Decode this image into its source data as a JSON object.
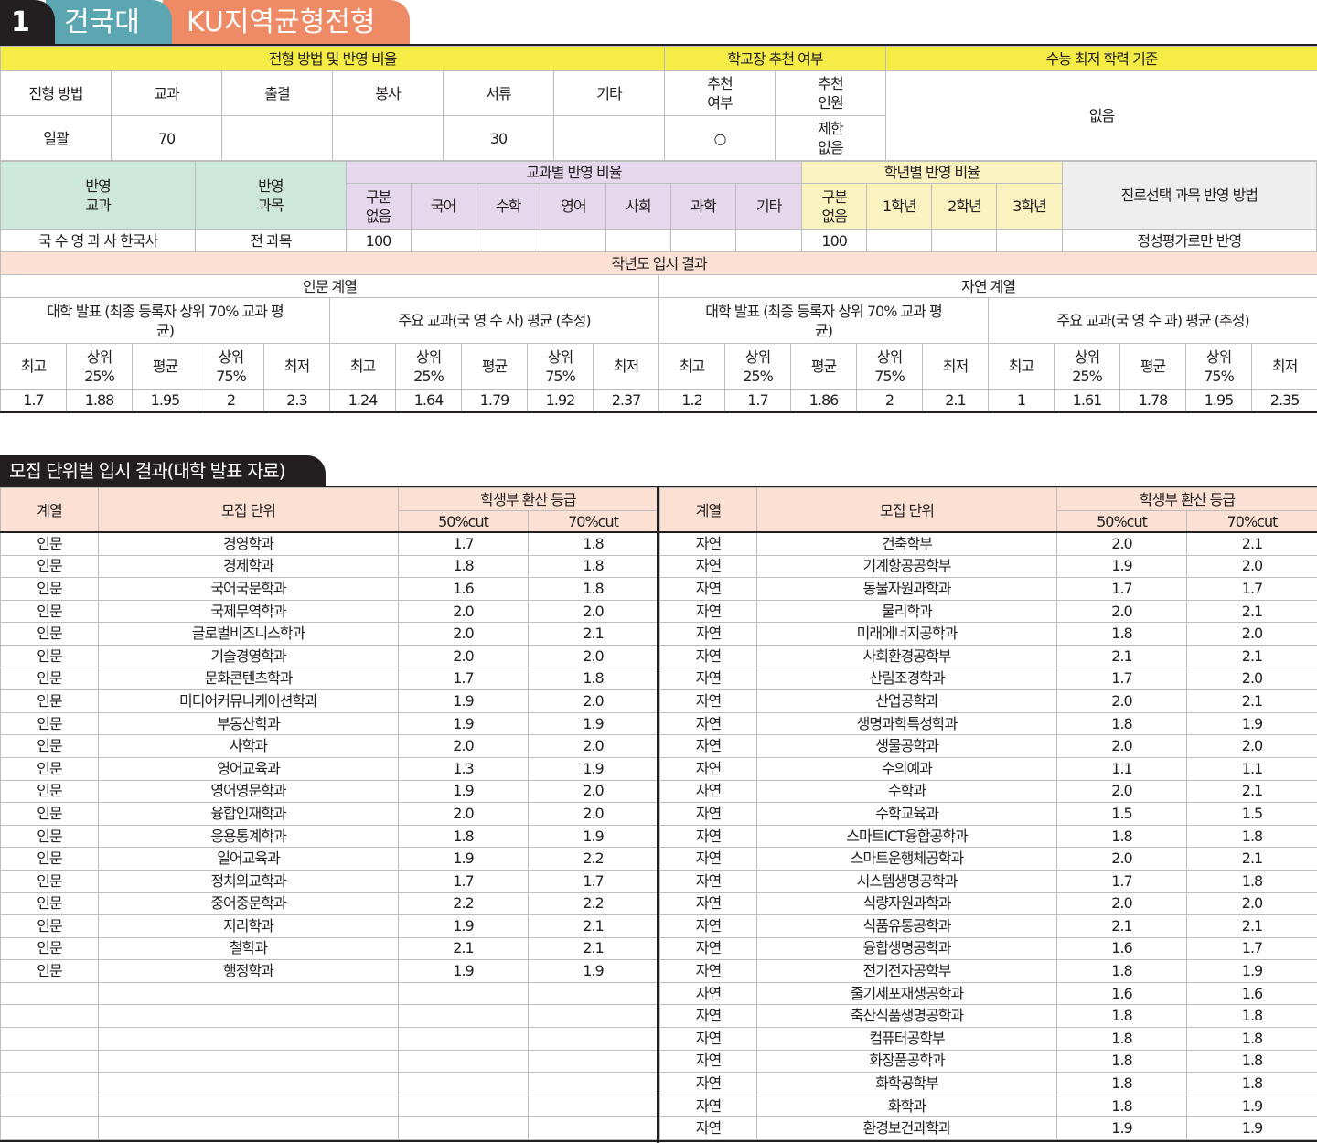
{
  "header": {
    "number": "1",
    "university": "건국대",
    "admission_type": "KU지역균형전형"
  },
  "t1": {
    "method_group": "전형 방법 및 반영 비율",
    "rec_group": "학교장 추천 여부",
    "min_group": "수능 최저 학력 기준",
    "cols": [
      "전형 방법",
      "교과",
      "출결",
      "봉사",
      "서류",
      "기타"
    ],
    "rec_cols": [
      "추천 여부",
      "추천 인원"
    ],
    "vals": [
      "일괄",
      "70",
      "",
      "",
      "30",
      ""
    ],
    "rec_vals": [
      "○",
      "제한 없음"
    ],
    "min_val": "없음"
  },
  "t2": {
    "reflect_subject": "반영 교과",
    "reflect_course": "반영 과목",
    "subj_group": "교과별 반영 비율",
    "grade_group": "학년별 반영 비율",
    "elective": "진로선택 과목 반영 방법",
    "subj_cols": [
      "구분 없음",
      "국어",
      "수학",
      "영어",
      "사회",
      "과학",
      "기타"
    ],
    "grade_cols": [
      "구분 없음",
      "1학년",
      "2학년",
      "3학년"
    ],
    "row": {
      "subject": "국 수 영 과 사 한국사",
      "course": "전 과목",
      "subj_vals": [
        "100",
        "",
        "",
        "",
        "",
        "",
        ""
      ],
      "grade_vals": [
        "100",
        "",
        "",
        ""
      ],
      "elective": "정성평가로만 반영"
    }
  },
  "t3": {
    "title": "작년도 입시 결과",
    "hum": "인문 계열",
    "nat": "자연 계열",
    "univ_hdr": "대학 발표 (최종 등록자 상위 70% 교과 평균)",
    "main_hum": "주요 교과(국 영 수 사) 평균 (추정)",
    "main_nat": "주요 교과(국 영 수 과) 평균 (추정)",
    "stat_cols": [
      "최고",
      "상위 25%",
      "평균",
      "상위 75%",
      "최저"
    ],
    "hum_univ": [
      "1.7",
      "1.88",
      "1.95",
      "2",
      "2.3"
    ],
    "hum_main": [
      "1.24",
      "1.64",
      "1.79",
      "1.92",
      "2.37"
    ],
    "nat_univ": [
      "1.2",
      "1.7",
      "1.86",
      "2",
      "2.1"
    ],
    "nat_main": [
      "1",
      "1.61",
      "1.78",
      "1.95",
      "2.35"
    ]
  },
  "sec2": {
    "title": "모집 단위별 입시 결과(대학 발표 자료)",
    "col_track": "계열",
    "col_unit": "모집 단위",
    "col_grade": "학생부 환산 등급",
    "col_50": "50%cut",
    "col_70": "70%cut"
  },
  "left_rows": [
    [
      "인문",
      "경영학과",
      "1.7",
      "1.8"
    ],
    [
      "인문",
      "경제학과",
      "1.8",
      "1.8"
    ],
    [
      "인문",
      "국어국문학과",
      "1.6",
      "1.8"
    ],
    [
      "인문",
      "국제무역학과",
      "2.0",
      "2.0"
    ],
    [
      "인문",
      "글로벌비즈니스학과",
      "2.0",
      "2.1"
    ],
    [
      "인문",
      "기술경영학과",
      "2.0",
      "2.0"
    ],
    [
      "인문",
      "문화콘텐츠학과",
      "1.7",
      "1.8"
    ],
    [
      "인문",
      "미디어커뮤니케이션학과",
      "1.9",
      "2.0"
    ],
    [
      "인문",
      "부동산학과",
      "1.9",
      "1.9"
    ],
    [
      "인문",
      "사학과",
      "2.0",
      "2.0"
    ],
    [
      "인문",
      "영어교육과",
      "1.3",
      "1.9"
    ],
    [
      "인문",
      "영어영문학과",
      "1.9",
      "2.0"
    ],
    [
      "인문",
      "융합인재학과",
      "2.0",
      "2.0"
    ],
    [
      "인문",
      "응용통계학과",
      "1.8",
      "1.9"
    ],
    [
      "인문",
      "일어교육과",
      "1.9",
      "2.2"
    ],
    [
      "인문",
      "정치외교학과",
      "1.7",
      "1.7"
    ],
    [
      "인문",
      "중어중문학과",
      "2.2",
      "2.2"
    ],
    [
      "인문",
      "지리학과",
      "1.9",
      "2.1"
    ],
    [
      "인문",
      "철학과",
      "2.1",
      "2.1"
    ],
    [
      "인문",
      "행정학과",
      "1.9",
      "1.9"
    ],
    [
      "",
      "",
      "",
      ""
    ],
    [
      "",
      "",
      "",
      ""
    ],
    [
      "",
      "",
      "",
      ""
    ],
    [
      "",
      "",
      "",
      ""
    ],
    [
      "",
      "",
      "",
      ""
    ],
    [
      "",
      "",
      "",
      ""
    ],
    [
      "",
      "",
      "",
      ""
    ]
  ],
  "right_rows": [
    [
      "자연",
      "건축학부",
      "2.0",
      "2.1"
    ],
    [
      "자연",
      "기계항공공학부",
      "1.9",
      "2.0"
    ],
    [
      "자연",
      "동물자원과학과",
      "1.7",
      "1.7"
    ],
    [
      "자연",
      "물리학과",
      "2.0",
      "2.1"
    ],
    [
      "자연",
      "미래에너지공학과",
      "1.8",
      "2.0"
    ],
    [
      "자연",
      "사회환경공학부",
      "2.1",
      "2.1"
    ],
    [
      "자연",
      "산림조경학과",
      "1.7",
      "2.0"
    ],
    [
      "자연",
      "산업공학과",
      "2.0",
      "2.1"
    ],
    [
      "자연",
      "생명과학특성학과",
      "1.8",
      "1.9"
    ],
    [
      "자연",
      "생물공학과",
      "2.0",
      "2.0"
    ],
    [
      "자연",
      "수의예과",
      "1.1",
      "1.1"
    ],
    [
      "자연",
      "수학과",
      "2.0",
      "2.1"
    ],
    [
      "자연",
      "수학교육과",
      "1.5",
      "1.5"
    ],
    [
      "자연",
      "스마트ICT융합공학과",
      "1.8",
      "1.8"
    ],
    [
      "자연",
      "스마트운행체공학과",
      "2.0",
      "2.1"
    ],
    [
      "자연",
      "시스템생명공학과",
      "1.7",
      "1.8"
    ],
    [
      "자연",
      "식량자원과학과",
      "2.0",
      "2.0"
    ],
    [
      "자연",
      "식품유통공학과",
      "2.1",
      "2.1"
    ],
    [
      "자연",
      "융합생명공학과",
      "1.6",
      "1.7"
    ],
    [
      "자연",
      "전기전자공학부",
      "1.8",
      "1.9"
    ],
    [
      "자연",
      "줄기세포재생공학과",
      "1.6",
      "1.6"
    ],
    [
      "자연",
      "축산식품생명공학과",
      "1.8",
      "1.8"
    ],
    [
      "자연",
      "컴퓨터공학부",
      "1.8",
      "1.8"
    ],
    [
      "자연",
      "화장품공학과",
      "1.8",
      "1.8"
    ],
    [
      "자연",
      "화학공학부",
      "1.8",
      "1.8"
    ],
    [
      "자연",
      "화학과",
      "1.8",
      "1.9"
    ],
    [
      "자연",
      "환경보건과학과",
      "1.9",
      "1.9"
    ]
  ]
}
